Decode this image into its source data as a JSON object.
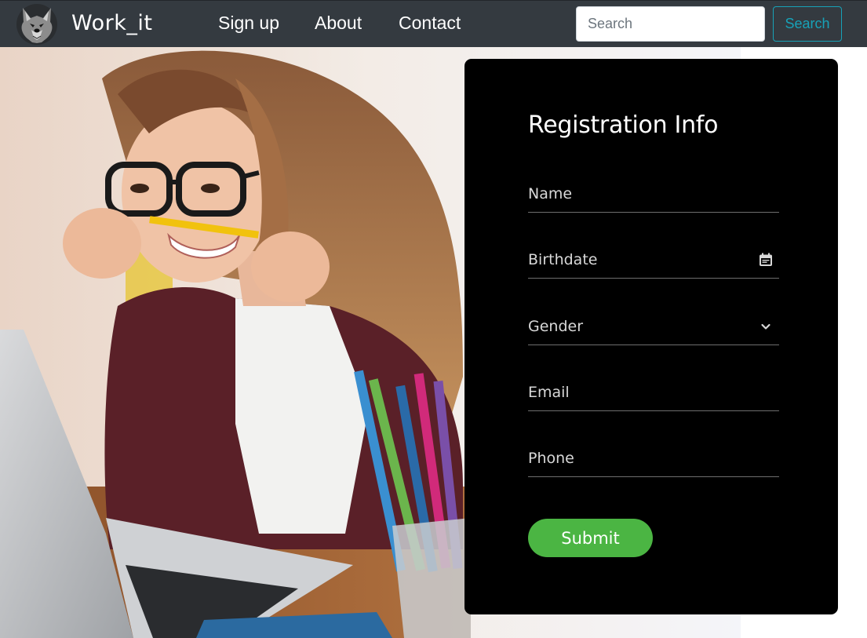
{
  "navbar": {
    "brand": "Work_it",
    "links": {
      "signup": "Sign up",
      "about": "About",
      "contact": "Contact"
    },
    "search": {
      "placeholder": "Search",
      "button_label": "Search"
    }
  },
  "form": {
    "title": "Registration Info",
    "fields": {
      "name": "Name",
      "birthdate": "Birthdate",
      "gender": "Gender",
      "email": "Email",
      "phone": "Phone"
    },
    "submit_label": "Submit"
  },
  "colors": {
    "navbar_bg": "#343a40",
    "search_outline": "#17a2b8",
    "card_bg": "#000000",
    "submit_bg": "#4bb543"
  }
}
